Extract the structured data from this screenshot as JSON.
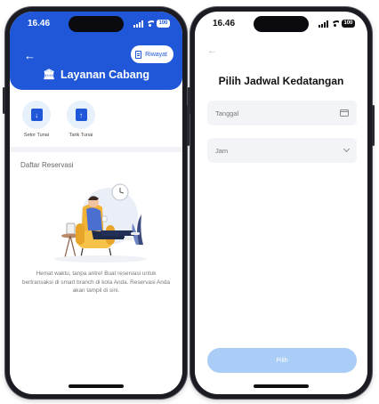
{
  "colors": {
    "primary": "#1f57d8",
    "light_blue": "#a9cdf6",
    "circle_bg": "#e6f1fb"
  },
  "left_screen": {
    "status": {
      "time": "16.46",
      "battery": "100"
    },
    "header": {
      "back_icon": "arrow-left-icon",
      "history_button": {
        "icon": "document-icon",
        "label": "Riwayat"
      },
      "title_icon": "bank-icon",
      "title": "Layanan Cabang"
    },
    "services": [
      {
        "icon": "cash-deposit-icon",
        "label": "Setor Tunai"
      },
      {
        "icon": "cash-withdraw-icon",
        "label": "Tarik Tunai"
      }
    ],
    "section_title": "Daftar Reservasi",
    "empty_state": {
      "illustration": "person-relaxing-in-armchair",
      "message": "Hemat waktu, tanpa antre! Buat reservasi untuk bertransaksi di smart branch di kota Anda. Reservasi Anda akan tampil di sini."
    }
  },
  "right_screen": {
    "status": {
      "time": "16.46",
      "battery": "100"
    },
    "back_icon": "arrow-left-icon",
    "title": "Pilih Jadwal Kedatangan",
    "date_field": {
      "placeholder": "Tanggal",
      "icon": "calendar-icon"
    },
    "time_field": {
      "placeholder": "Jam",
      "icon": "chevron-down-icon"
    },
    "submit_label": "Pilih"
  }
}
